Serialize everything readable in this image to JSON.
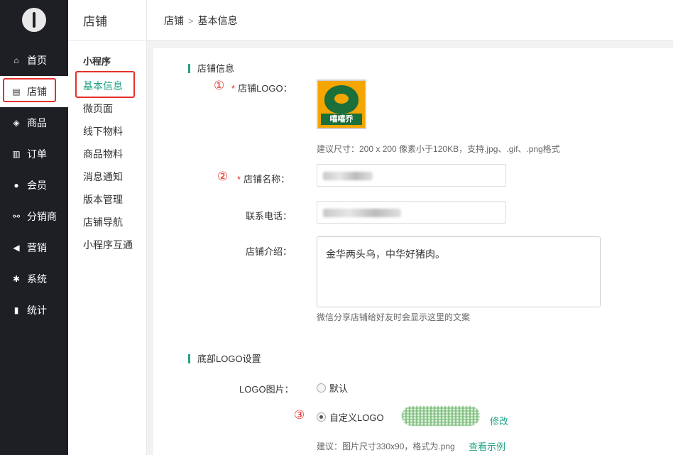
{
  "nav": {
    "items": [
      {
        "label": "首页",
        "icon": "home-icon",
        "glyph": "⌂"
      },
      {
        "label": "店铺",
        "icon": "store-icon",
        "glyph": "▤"
      },
      {
        "label": "商品",
        "icon": "box-icon",
        "glyph": "◈"
      },
      {
        "label": "订单",
        "icon": "basket-icon",
        "glyph": "▥"
      },
      {
        "label": "会员",
        "icon": "member-icon",
        "glyph": "●"
      },
      {
        "label": "分销商",
        "icon": "sitemap-icon",
        "glyph": "⚯"
      },
      {
        "label": "营销",
        "icon": "megaphone-icon",
        "glyph": "◀"
      },
      {
        "label": "系统",
        "icon": "gear-icon",
        "glyph": "✱"
      },
      {
        "label": "统计",
        "icon": "bar-chart-icon",
        "glyph": "▮"
      }
    ]
  },
  "subnav": {
    "title": "店铺",
    "group": "小程序",
    "items": [
      "基本信息",
      "微页面",
      "线下物料",
      "商品物料",
      "消息通知",
      "版本管理",
      "店铺导航",
      "小程序互通"
    ]
  },
  "breadcrumb": {
    "root": "店铺",
    "sep": ">",
    "current": "基本信息"
  },
  "store_info": {
    "section_title": "店铺信息",
    "logo_label": "店铺LOGO：",
    "logo_text": "嘻嘻乔",
    "logo_hint": "建议尺寸：200 x 200 像素小于120KB，支持.jpg、.gif、.png格式",
    "name_label": "店铺名称：",
    "phone_label": "联系电话：",
    "intro_label": "店铺介绍：",
    "intro_value": "金华两头乌，中华好猪肉。",
    "intro_hint": "微信分享店铺给好友时会显示这里的文案",
    "required_mark": "*"
  },
  "footer_logo": {
    "section_title": "底部LOGO设置",
    "image_label": "LOGO图片：",
    "option_default": "默认",
    "option_custom": "自定义LOGO",
    "modify_link": "修改",
    "hint": "建议：图片尺寸330x90，格式为.png",
    "example_link": "查看示例"
  },
  "annotations": {
    "one": "①",
    "two": "②",
    "three": "③"
  },
  "colors": {
    "accent": "#23a386",
    "highlight": "#e4302b",
    "nav_bg": "#1d1f24"
  }
}
